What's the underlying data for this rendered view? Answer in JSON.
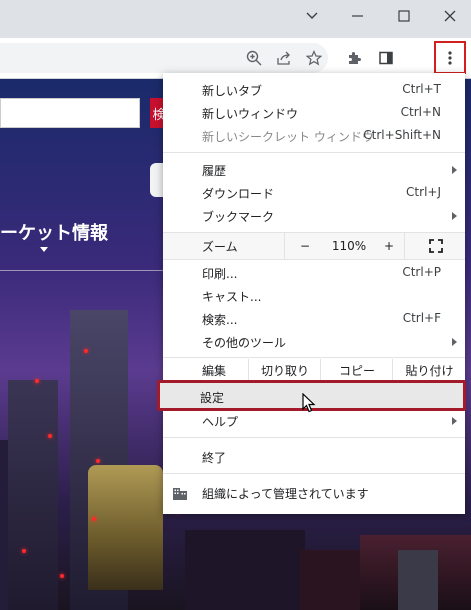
{
  "window": {
    "controls": [
      "chevron-down-icon",
      "minimize-icon",
      "maximize-icon",
      "close-icon"
    ]
  },
  "toolbar": {
    "icons": [
      "zoom-icon",
      "share-icon",
      "star-icon",
      "extensions-icon",
      "side-panel-icon",
      "menu-icon"
    ]
  },
  "page": {
    "search_button_text": "検",
    "market_heading": "ーケット情報"
  },
  "menu": {
    "new_tab": {
      "label": "新しいタブ",
      "shortcut": "Ctrl+T"
    },
    "new_window": {
      "label": "新しいウィンドウ",
      "shortcut": "Ctrl+N"
    },
    "new_incognito": {
      "label": "新しいシークレット ウィンドウ",
      "shortcut": "Ctrl+Shift+N"
    },
    "history": {
      "label": "履歴"
    },
    "downloads": {
      "label": "ダウンロード",
      "shortcut": "Ctrl+J"
    },
    "bookmarks": {
      "label": "ブックマーク"
    },
    "zoom": {
      "label": "ズーム",
      "minus": "−",
      "value": "110%",
      "plus": "+"
    },
    "print": {
      "label": "印刷...",
      "shortcut": "Ctrl+P"
    },
    "cast": {
      "label": "キャスト..."
    },
    "find": {
      "label": "検索...",
      "shortcut": "Ctrl+F"
    },
    "more_tools": {
      "label": "その他のツール"
    },
    "edit": {
      "label": "編集",
      "cut": "切り取り",
      "copy": "コピー",
      "paste": "貼り付け"
    },
    "settings": {
      "label": "設定"
    },
    "help": {
      "label": "ヘルプ"
    },
    "exit": {
      "label": "終了"
    },
    "managed": {
      "label": "組織によって管理されています"
    }
  },
  "colors": {
    "highlight_red": "#d41f1f",
    "settings_outline": "#a31a2a",
    "menu_background": "#ffffff"
  }
}
